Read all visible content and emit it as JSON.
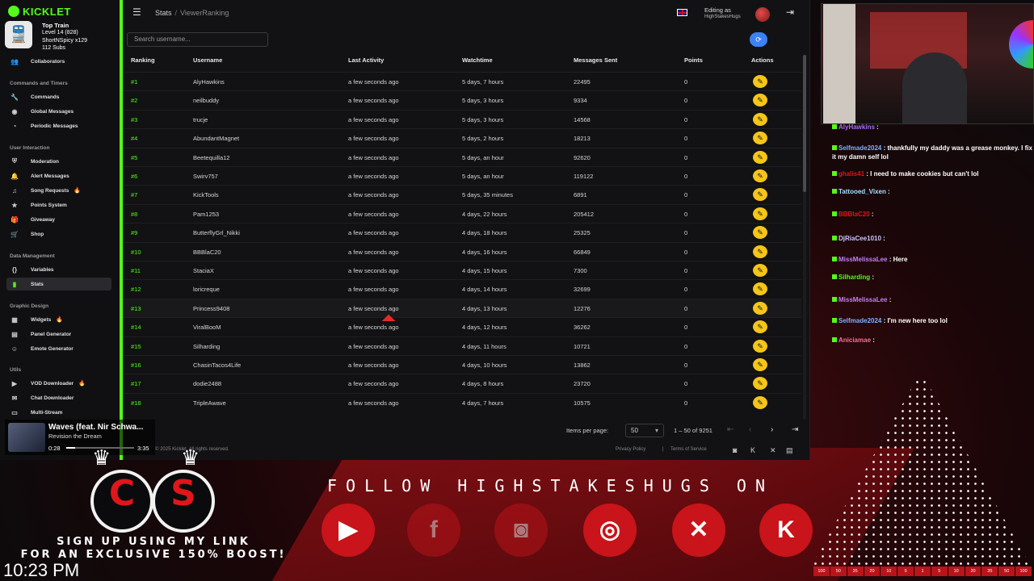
{
  "brand": "KICKLET",
  "train": {
    "title": "Top Train",
    "level": "Level 14 (828)",
    "top": "ShortNSpicy x129",
    "subs": "112 Subs"
  },
  "sidebar": {
    "items_top": [
      {
        "label": "Collaborators",
        "icon": "users-icon"
      }
    ],
    "sections": [
      {
        "title": "Commands and Timers",
        "items": [
          "Commands",
          "Global Messages",
          "Periodic Messages"
        ]
      },
      {
        "title": "User Interaction",
        "items": [
          "Moderation",
          "Alert Messages",
          "Song Requests",
          "Points System",
          "Giveaway",
          "Shop"
        ]
      },
      {
        "title": "Data Management",
        "items": [
          "Variables",
          "Stats"
        ]
      },
      {
        "title": "Graphic Design",
        "items": [
          "Widgets",
          "Panel Generator",
          "Emote Generator"
        ]
      },
      {
        "title": "Utils",
        "items": [
          "VOD Downloader",
          "Chat Downloader",
          "Multi-Stream"
        ]
      }
    ]
  },
  "breadcrumb": {
    "root": "Stats",
    "sep": "/",
    "current": "ViewerRanking"
  },
  "header": {
    "editing_label": "Editing as",
    "editing_user": "HighStakesHugs"
  },
  "search": {
    "placeholder": "Search username..."
  },
  "table": {
    "headers": [
      "Ranking",
      "Username",
      "Last Activity",
      "Watchtime",
      "Messages Sent",
      "Points",
      "Actions"
    ],
    "rows": [
      [
        "#1",
        "AlyHawkins",
        "a few seconds ago",
        "5 days, 7 hours",
        "22495",
        "0"
      ],
      [
        "#2",
        "neilbuddy",
        "a few seconds ago",
        "5 days, 3 hours",
        "9334",
        "0"
      ],
      [
        "#3",
        "trucje",
        "a few seconds ago",
        "5 days, 3 hours",
        "14568",
        "0"
      ],
      [
        "#4",
        "AbundantMagnet",
        "a few seconds ago",
        "5 days, 2 hours",
        "18213",
        "0"
      ],
      [
        "#5",
        "Beetequilla12",
        "a few seconds ago",
        "5 days, an hour",
        "92620",
        "0"
      ],
      [
        "#6",
        "Swirv757",
        "a few seconds ago",
        "5 days, an hour",
        "119122",
        "0"
      ],
      [
        "#7",
        "KickTools",
        "a few seconds ago",
        "5 days, 35 minutes",
        "6891",
        "0"
      ],
      [
        "#8",
        "Pam1253",
        "a few seconds ago",
        "4 days, 22 hours",
        "205412",
        "0"
      ],
      [
        "#9",
        "ButterflyGrl_Nikki",
        "a few seconds ago",
        "4 days, 18 hours",
        "25325",
        "0"
      ],
      [
        "#10",
        "BBBlaC20",
        "a few seconds ago",
        "4 days, 16 hours",
        "66849",
        "0"
      ],
      [
        "#11",
        "StaciaX",
        "a few seconds ago",
        "4 days, 15 hours",
        "7300",
        "0"
      ],
      [
        "#12",
        "loricreque",
        "a few seconds ago",
        "4 days, 14 hours",
        "32699",
        "0"
      ],
      [
        "#13",
        "Princess9408",
        "a few seconds ago",
        "4 days, 13 hours",
        "12276",
        "0"
      ],
      [
        "#14",
        "ViralBooM",
        "a few seconds ago",
        "4 days, 12 hours",
        "36262",
        "0"
      ],
      [
        "#15",
        "Silharding",
        "a few seconds ago",
        "4 days, 11 hours",
        "10721",
        "0"
      ],
      [
        "#16",
        "ChasinTacos4Life",
        "a few seconds ago",
        "4 days, 10 hours",
        "13862",
        "0"
      ],
      [
        "#17",
        "dodie2488",
        "a few seconds ago",
        "4 days, 8 hours",
        "23720",
        "0"
      ],
      [
        "#18",
        "TripleAwave",
        "a few seconds ago",
        "4 days, 7 hours",
        "10575",
        "0"
      ]
    ]
  },
  "pager": {
    "items_label": "Items per page:",
    "per_page": "50",
    "range": "1 – 50 of 9251"
  },
  "footer": {
    "copyright": "© 2025 Kicklet. All rights reserved.",
    "privacy": "Privacy Policy",
    "sep": "|",
    "terms": "Terms of Service"
  },
  "music": {
    "title": "Waves (feat. Nir Schwa...",
    "artist": "Revision the Dream",
    "elapsed": "0:28",
    "total": "3:35",
    "progress": 0.13
  },
  "overlay": {
    "signup1": "SIGN UP USING MY LINK",
    "signup2": "FOR AN EXCLUSIVE 150% BOOST!",
    "clock": "10:23 PM",
    "follow": "FOLLOW HIGHSTAKESHUGS ON",
    "cs_left": "C",
    "cs_right": "S"
  },
  "chat": [
    {
      "user": "AlyHawkins",
      "sep": " :",
      "text": "",
      "color": "#a56cf0"
    },
    {
      "user": "Selfmade2024",
      "sep": " :",
      "text": " thankfully my daddy was a grease monkey. I fix it my damn self lol",
      "color": "#7fb2ff"
    },
    {
      "user": "ghalis41",
      "sep": " :",
      "text": " I need to make cookies but can't lol",
      "color": "#e0161b"
    },
    {
      "user": "Tattooed_Vixen",
      "sep": " :",
      "text": "",
      "color": "#a0e0ff"
    },
    {
      "user": "BBBlaC20",
      "sep": " :",
      "text": "",
      "color": "#e0161b"
    },
    {
      "user": "DjRiaCee1010",
      "sep": " :",
      "text": "",
      "color": "#c8c8ff"
    },
    {
      "user": "MissMelissaLee",
      "sep": " :",
      "text": " Here",
      "color": "#c77dff"
    },
    {
      "user": "Silharding",
      "sep": " :",
      "text": "",
      "color": "#53fc18"
    },
    {
      "user": "MissMelissaLee",
      "sep": " :",
      "text": "",
      "color": "#c77dff"
    },
    {
      "user": "Selfmade2024",
      "sep": " :",
      "text": " I'm new here too lol",
      "color": "#7fb2ff"
    },
    {
      "user": "Aniciamae",
      "sep": " :",
      "text": "",
      "color": "#ff6b9a"
    }
  ],
  "bar_scale": [
    "100",
    "50",
    "35",
    "20",
    "10",
    "5",
    "1",
    "5",
    "10",
    "20",
    "35",
    "50",
    "100"
  ],
  "colors": {
    "accent": "#53fc18",
    "action": "#f5c518",
    "brand_red": "#c8141a"
  }
}
